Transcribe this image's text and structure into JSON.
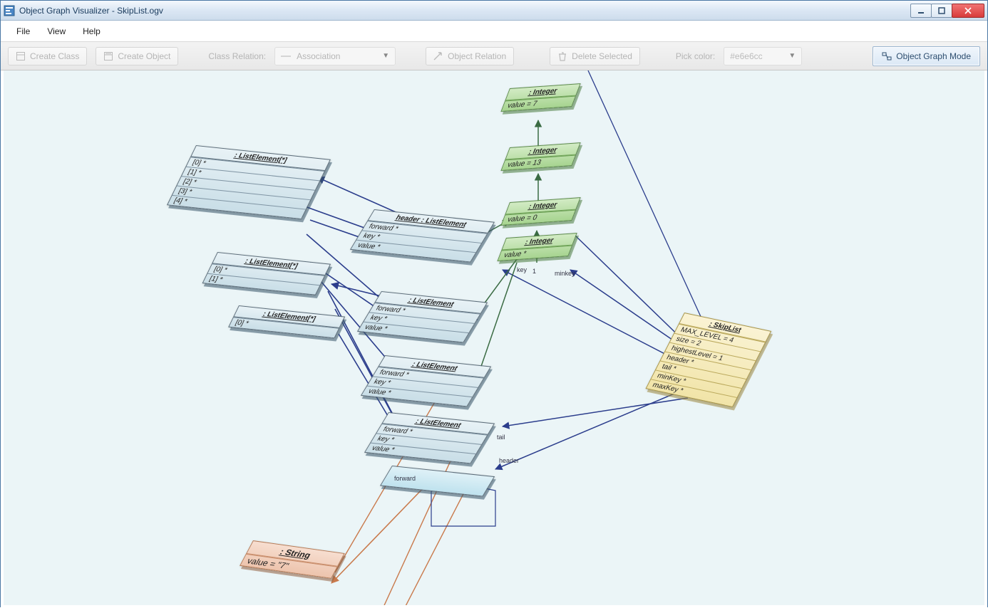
{
  "window": {
    "title": "Object Graph Visualizer - SkipList.ogv"
  },
  "menu": {
    "file": "File",
    "view": "View",
    "help": "Help"
  },
  "toolbar": {
    "create_class": "Create Class",
    "create_object": "Create Object",
    "class_relation_label": "Class Relation:",
    "class_relation_value": "Association",
    "object_relation": "Object Relation",
    "delete_selected": "Delete Selected",
    "pick_color_label": "Pick color:",
    "pick_color_value": "#e6e6cc",
    "mode": "Object Graph Mode"
  },
  "diagram": {
    "list0": {
      "title": ": ListElement[*]",
      "rows": [
        "[0] *",
        "[1] *",
        "[2] *",
        "[3] *",
        "[4] *"
      ]
    },
    "list1": {
      "title": ": ListElement[*]",
      "rows": [
        "[0] *",
        "[1] *"
      ]
    },
    "list2": {
      "title": ": ListElement[*]",
      "rows": [
        "[0] *"
      ]
    },
    "headerNode": {
      "title": "header : ListElement",
      "rows": [
        "forward *",
        "key *",
        "value *"
      ]
    },
    "node1": {
      "title": ": ListElement",
      "rows": [
        "forward *",
        "key *",
        "value *"
      ]
    },
    "node2": {
      "title": ": ListElement",
      "rows": [
        "forward *",
        "key *",
        "value *"
      ]
    },
    "node3": {
      "title": ": ListElement",
      "rows": [
        "forward *",
        "key *",
        "value *"
      ]
    },
    "int0": {
      "title": ": Integer",
      "rows": [
        "value = 7"
      ]
    },
    "int1": {
      "title": ": Integer",
      "rows": [
        "value = 13"
      ]
    },
    "int2": {
      "title": ": Integer",
      "rows": [
        "value = 0"
      ]
    },
    "int3": {
      "title": ": Integer",
      "rows": [
        "value *"
      ]
    },
    "skiplist": {
      "title": ": SkipList",
      "rows": [
        "MAX_LEVEL = 4",
        "size = 2",
        "highestLevel = 1",
        "header *",
        "tail *",
        "minKey *",
        "maxKey *"
      ]
    },
    "string0": {
      "title": ": String",
      "rows": [
        "value = \"7\""
      ]
    },
    "labels": {
      "forward": "forward",
      "header": "header",
      "tail": "tail",
      "key": "key",
      "minkey": "minkey",
      "one": "1"
    }
  }
}
